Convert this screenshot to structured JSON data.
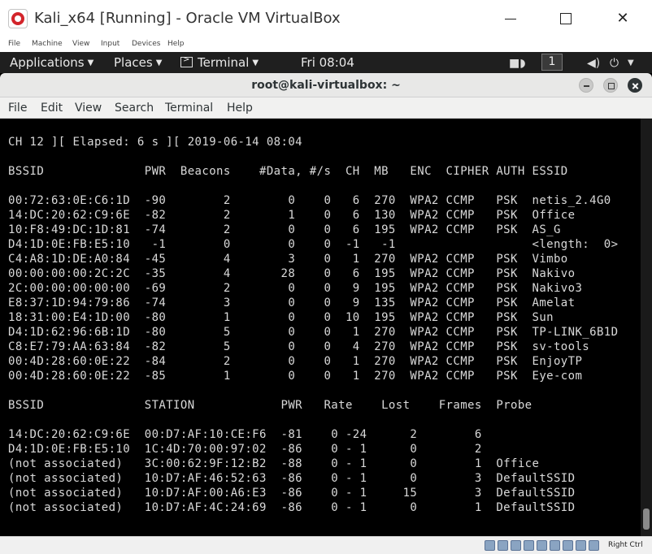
{
  "window": {
    "title": "Kali_x64 [Running] - Oracle VM VirtualBox",
    "menu": [
      "File",
      "Machine",
      "View",
      "Input",
      "Devices",
      "Help"
    ],
    "controls": {
      "minimize": "minimize-icon",
      "maximize": "maximize-icon",
      "close": "close-icon"
    }
  },
  "panel": {
    "applications": "Applications",
    "places": "Places",
    "terminal": "Terminal",
    "clock": "Fri 08:04",
    "workspace": "1"
  },
  "terminal": {
    "title": "root@kali-virtualbox: ~",
    "menu": [
      "File",
      "Edit",
      "View",
      "Search",
      "Terminal",
      "Help"
    ],
    "lines": [
      "CH 12 ][ Elapsed: 6 s ][ 2019-06-14 08:04",
      "",
      "BSSID              PWR  Beacons    #Data, #/s  CH  MB   ENC  CIPHER AUTH ESSID",
      "",
      "00:72:63:0E:C6:1D  -90        2        0    0   6  270  WPA2 CCMP   PSK  netis_2.4G0",
      "14:DC:20:62:C9:6E  -82        2        1    0   6  130  WPA2 CCMP   PSK  Office",
      "10:F8:49:DC:1D:81  -74        2        0    0   6  195  WPA2 CCMP   PSK  AS_G",
      "D4:1D:0E:FB:E5:10   -1        0        0    0  -1   -1                   <length:  0>",
      "C4:A8:1D:DE:A0:84  -45        4        3    0   1  270  WPA2 CCMP   PSK  Vimbo",
      "00:00:00:00:2C:2C  -35        4       28    0   6  195  WPA2 CCMP   PSK  Nakivo",
      "2C:00:00:00:00:00  -69        2        0    0   9  195  WPA2 CCMP   PSK  Nakivo3",
      "E8:37:1D:94:79:86  -74        3        0    0   9  135  WPA2 CCMP   PSK  Amelat",
      "18:31:00:E4:1D:00  -80        1        0    0  10  195  WPA2 CCMP   PSK  Sun",
      "D4:1D:62:96:6B:1D  -80        5        0    0   1  270  WPA2 CCMP   PSK  TP-LINK_6B1D",
      "C8:E7:79:AA:63:84  -82        5        0    0   4  270  WPA2 CCMP   PSK  sv-tools",
      "00:4D:28:60:0E:22  -84        2        0    0   1  270  WPA2 CCMP   PSK  EnjoyTP",
      "00:4D:28:60:0E:22  -85        1        0    0   1  270  WPA2 CCMP   PSK  Eye-com",
      "",
      "BSSID              STATION            PWR   Rate    Lost    Frames  Probe",
      "",
      "14:DC:20:62:C9:6E  00:D7:AF:10:CE:F6  -81    0 -24      2        6",
      "D4:1D:0E:FB:E5:10  1C:4D:70:00:97:02  -86    0 - 1      0        2",
      "(not associated)   3C:00:62:9F:12:B2  -88    0 - 1      0        1  Office",
      "(not associated)   10:D7:AF:46:52:63  -86    0 - 1      0        3  DefaultSSID",
      "(not associated)   10:D7:AF:00:A6:E3  -86    0 - 1     15        3  DefaultSSID",
      "(not associated)   10:D7:AF:4C:24:69  -86    0 - 1      0        1  DefaultSSID"
    ]
  },
  "statusbar": {
    "host_key": "Right Ctrl"
  },
  "colors": {
    "panel_bg": "#1f1f1f",
    "terminal_bg": "#000000",
    "terminal_fg": "#d9d9d9"
  }
}
